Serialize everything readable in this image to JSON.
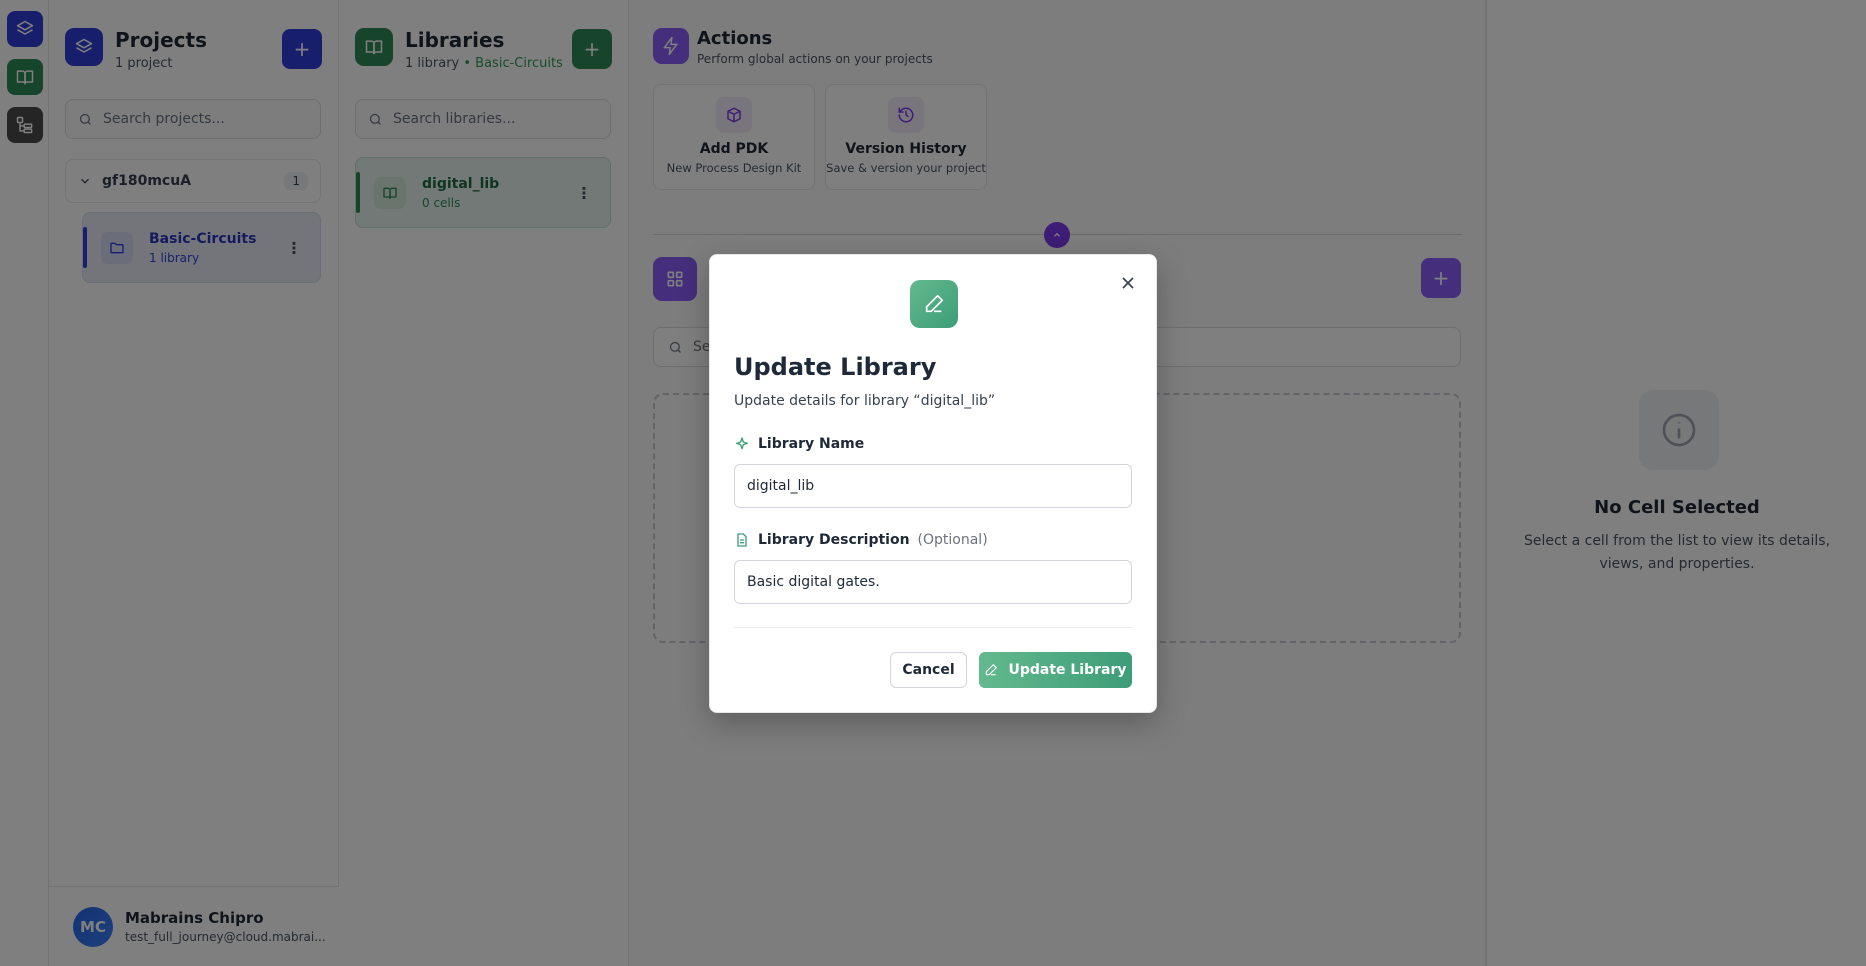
{
  "rail": {
    "items": [
      {
        "icon": "layers-icon",
        "color": "#2f3fd8"
      },
      {
        "icon": "book-icon",
        "color": "#2e8b57"
      },
      {
        "icon": "hierarchy-icon",
        "color": "#4b4b4b"
      }
    ]
  },
  "projects": {
    "title": "Projects",
    "subtitle": "1 project",
    "add_label": "+",
    "search_placeholder": "Search projects...",
    "group": {
      "name": "gf180mcuA",
      "count": "1"
    },
    "items": [
      {
        "name": "Basic-Circuits",
        "sub": "1 library"
      }
    ]
  },
  "libraries": {
    "title": "Libraries",
    "subtitle_count": "1 library",
    "subtitle_sep": " • ",
    "subtitle_project": "Basic-Circuits",
    "add_label": "+",
    "search_placeholder": "Search libraries...",
    "items": [
      {
        "name": "digital_lib",
        "sub": "0 cells"
      }
    ]
  },
  "actions": {
    "title": "Actions",
    "subtitle": "Perform global actions on your projects",
    "cards": [
      {
        "title": "Add PDK",
        "sub": "New Process Design Kit",
        "icon": "package-icon"
      },
      {
        "title": "Version History",
        "sub": "Save & version your project",
        "icon": "history-icon"
      }
    ],
    "cells_add_label": "+",
    "cells_search_placeholder": "Se"
  },
  "detail": {
    "title": "No Cell Selected",
    "subtitle": "Select a cell from the list to view its details, views, and properties."
  },
  "user": {
    "initials": "MC",
    "name": "Mabrains Chipro",
    "email": "test_full_journey@cloud.mabrai..."
  },
  "modal": {
    "title": "Update Library",
    "description": "Update details for library “digital_lib”",
    "name_label": "Library Name",
    "name_value": "digital_lib",
    "desc_label": "Library Description",
    "desc_optional": "(Optional)",
    "desc_value": "Basic digital gates.",
    "cancel_label": "Cancel",
    "submit_label": "Update Library"
  },
  "colors": {
    "projects_accent": "#2f3fd8",
    "libraries_accent": "#2e8b57",
    "actions_accent": "#7c3aed",
    "modal_accent": "#4aa87f"
  }
}
